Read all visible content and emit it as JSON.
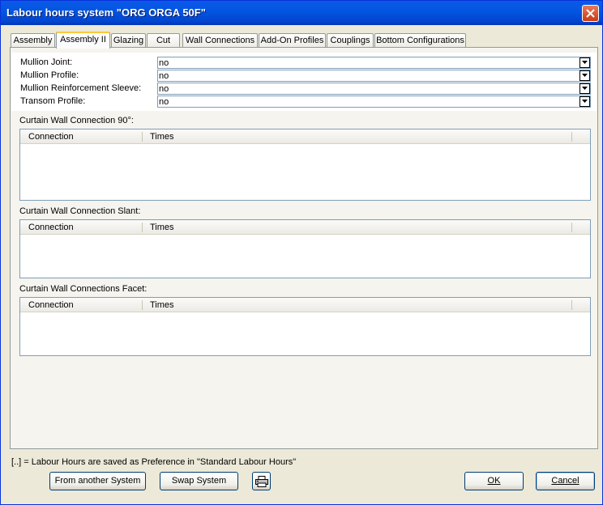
{
  "window": {
    "title": "Labour hours system \"ORG ORGA 50F\""
  },
  "tabs": [
    {
      "label": "Assembly"
    },
    {
      "label": "Assembly II"
    },
    {
      "label": "Glazing"
    },
    {
      "label": "Cut"
    },
    {
      "label": "Wall Connections"
    },
    {
      "label": "Add-On Profiles"
    },
    {
      "label": "Couplings"
    },
    {
      "label": "Bottom Configurations"
    }
  ],
  "fields": [
    {
      "label": "Mullion Joint:",
      "value": "no"
    },
    {
      "label": "Mullion Profile:",
      "value": "no"
    },
    {
      "label": "Mullion Reinforcement Sleeve:",
      "value": "no"
    },
    {
      "label": "Transom Profile:",
      "value": "no"
    }
  ],
  "sections": [
    {
      "title": "Curtain Wall Connection 90°:",
      "columns": [
        "Connection",
        "Times"
      ]
    },
    {
      "title": "Curtain Wall Connection Slant:",
      "columns": [
        "Connection",
        "Times"
      ]
    },
    {
      "title": "Curtain Wall Connections Facet:",
      "columns": [
        "Connection",
        "Times"
      ]
    }
  ],
  "footer": {
    "note": "[..] = Labour Hours are saved as Preference in \"Standard Labour Hours\"",
    "from_another_system": "From another System",
    "swap_system": "Swap System",
    "ok_label": "OK",
    "cancel_label": "Cancel"
  },
  "colors": {
    "titlebar": "#0456e1",
    "active_tab_accent": "#ffc83c",
    "close_button": "#c83b14"
  }
}
